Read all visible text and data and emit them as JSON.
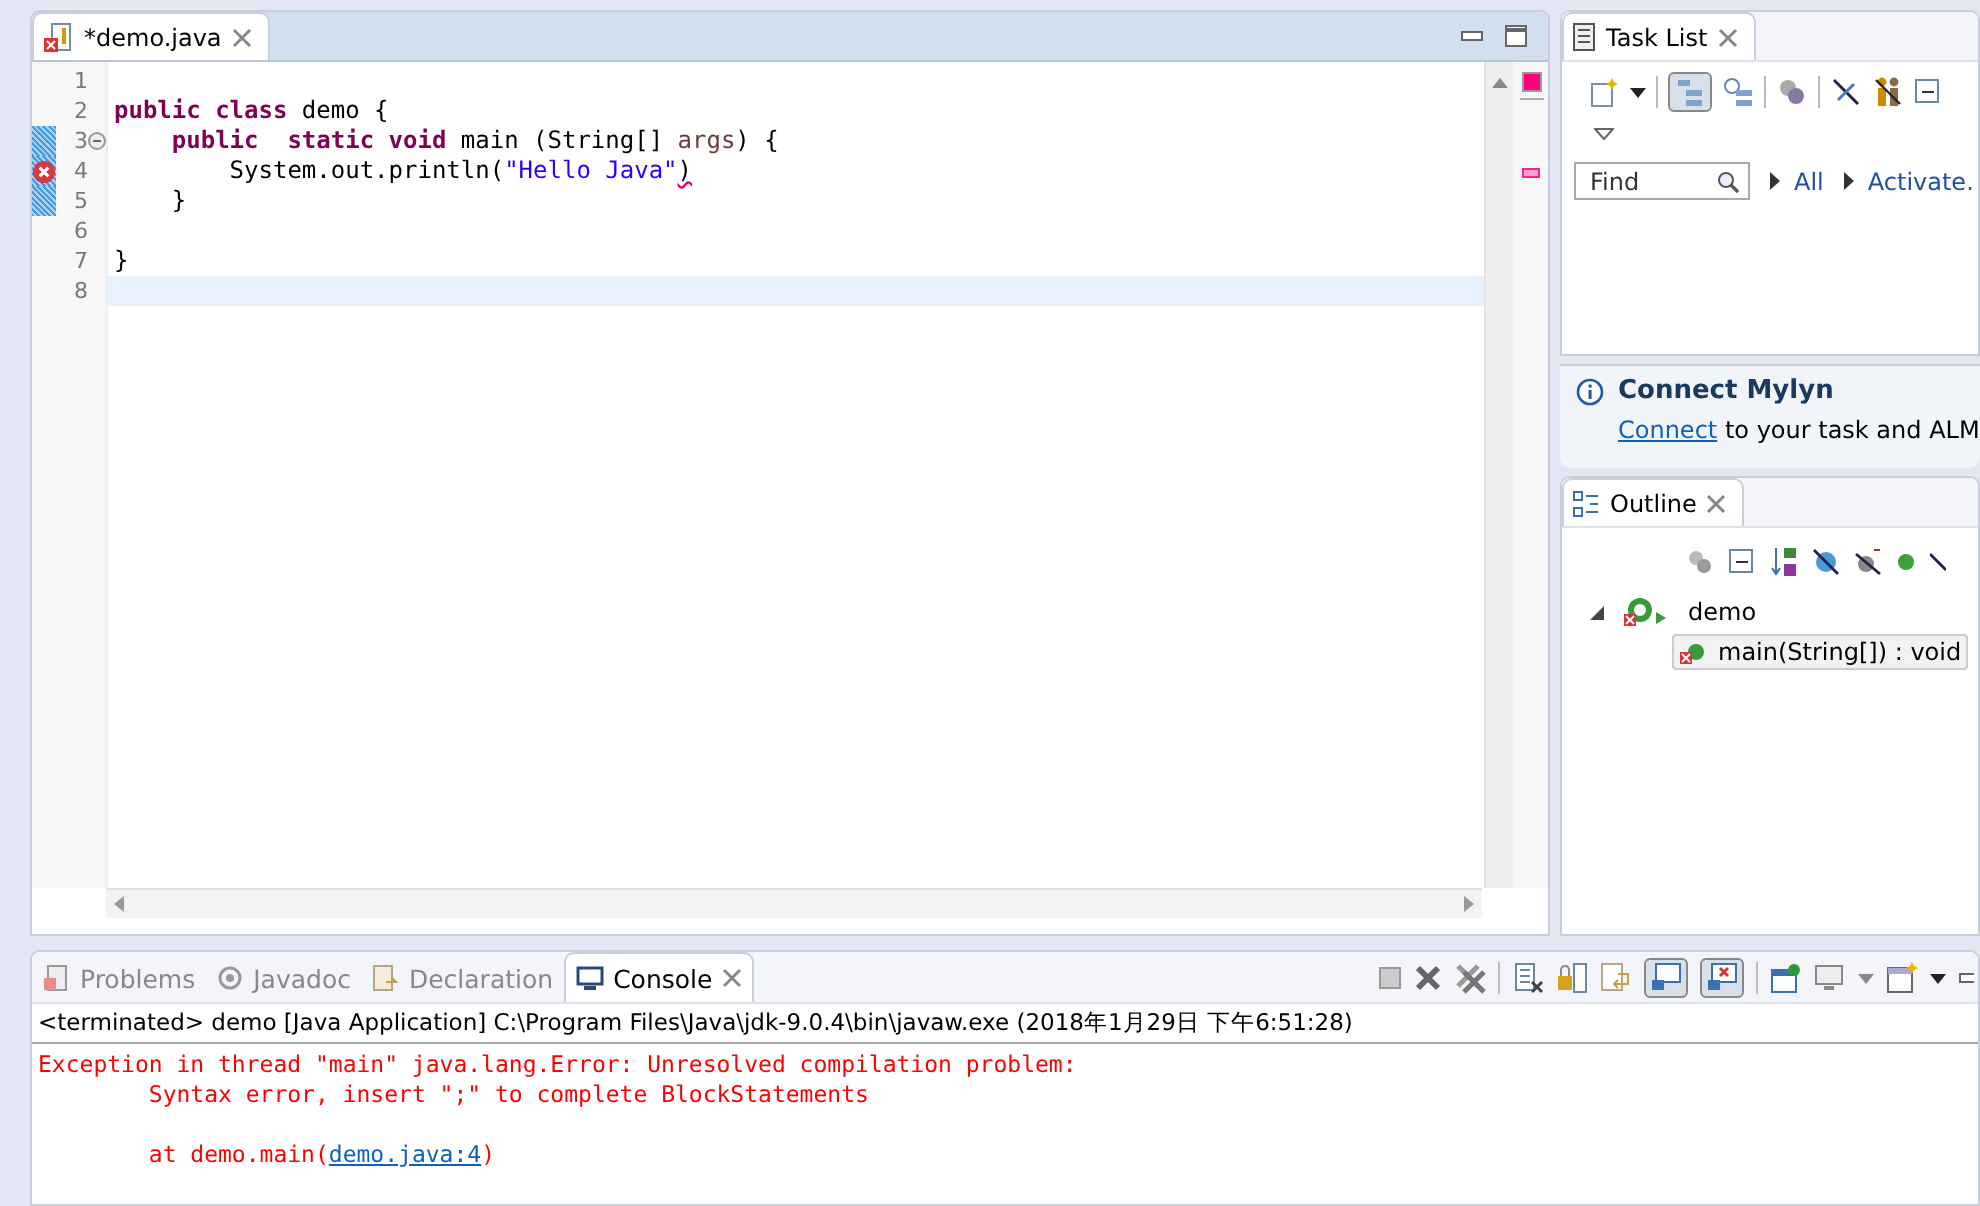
{
  "editor": {
    "tab": {
      "title": "*demo.java",
      "selected": true
    },
    "lines": [
      {
        "number": "1",
        "changed": false,
        "error": false,
        "foldable": false,
        "current": false
      },
      {
        "number": "2",
        "tokens": [
          {
            "kind": "keyword",
            "text": "public class"
          },
          {
            "kind": "plain",
            "text": " demo {"
          }
        ],
        "changed": false,
        "error": false,
        "foldable": false,
        "current": false
      },
      {
        "number": "3",
        "tokens": [
          {
            "kind": "keyword",
            "text": "    public  static void"
          },
          {
            "kind": "plain",
            "text": " main (String[] "
          },
          {
            "kind": "param",
            "text": "args"
          },
          {
            "kind": "plain",
            "text": ") {"
          }
        ],
        "changed": true,
        "error": false,
        "foldable": true,
        "current": false
      },
      {
        "number": "4",
        "tokens": [
          {
            "kind": "plain",
            "text": "        System.out.println("
          },
          {
            "kind": "string",
            "text": "\"Hello Java\""
          },
          {
            "kind": "error",
            "text": ")"
          }
        ],
        "changed": true,
        "error": true,
        "foldable": false,
        "current": false
      },
      {
        "number": "5",
        "tokens": [
          {
            "kind": "plain",
            "text": "    }"
          }
        ],
        "changed": true,
        "error": false,
        "foldable": false,
        "current": false
      },
      {
        "number": "6",
        "changed": false,
        "error": false,
        "foldable": false,
        "current": false
      },
      {
        "number": "7",
        "tokens": [
          {
            "kind": "plain",
            "text": "}"
          }
        ],
        "changed": false,
        "error": false,
        "foldable": false,
        "current": false
      },
      {
        "number": "8",
        "changed": false,
        "error": false,
        "foldable": false,
        "current": true
      }
    ]
  },
  "task_list": {
    "tab": {
      "title": "Task List",
      "selected": true
    },
    "find": {
      "placeholder": "Find"
    },
    "links": [
      "All",
      "Activate."
    ]
  },
  "connect_mylyn": {
    "title": "Connect Mylyn",
    "link": "Connect",
    "text": "to your task and ALM"
  },
  "outline": {
    "tab": {
      "title": "Outline",
      "selected": true
    },
    "tree": [
      {
        "label": "demo",
        "expanded": true,
        "selected": false,
        "children": [
          {
            "label": "main(String[]) : void",
            "selected": true
          }
        ]
      }
    ]
  },
  "console": {
    "tabs": [
      {
        "label": "Problems",
        "selected": false
      },
      {
        "label": "Javadoc",
        "selected": false
      },
      {
        "label": "Declaration",
        "selected": false
      },
      {
        "label": "Console",
        "selected": true
      }
    ],
    "header": "<terminated> demo [Java Application] C:\\Program Files\\Java\\jdk-9.0.4\\bin\\javaw.exe (2018年1月29日 下午6:51:28)",
    "output": [
      {
        "parts": [
          {
            "kind": "error",
            "text": "Exception in thread \"main\" java.lang.Error: Unresolved compilation problem: "
          }
        ]
      },
      {
        "parts": [
          {
            "kind": "error",
            "text": "\tSyntax error, insert \";\" to complete BlockStatements"
          }
        ]
      },
      {
        "parts": [
          {
            "kind": "error",
            "text": "\n\tat demo.main("
          },
          {
            "kind": "link",
            "text": "demo.java:4"
          },
          {
            "kind": "error",
            "text": ")"
          }
        ]
      }
    ]
  }
}
